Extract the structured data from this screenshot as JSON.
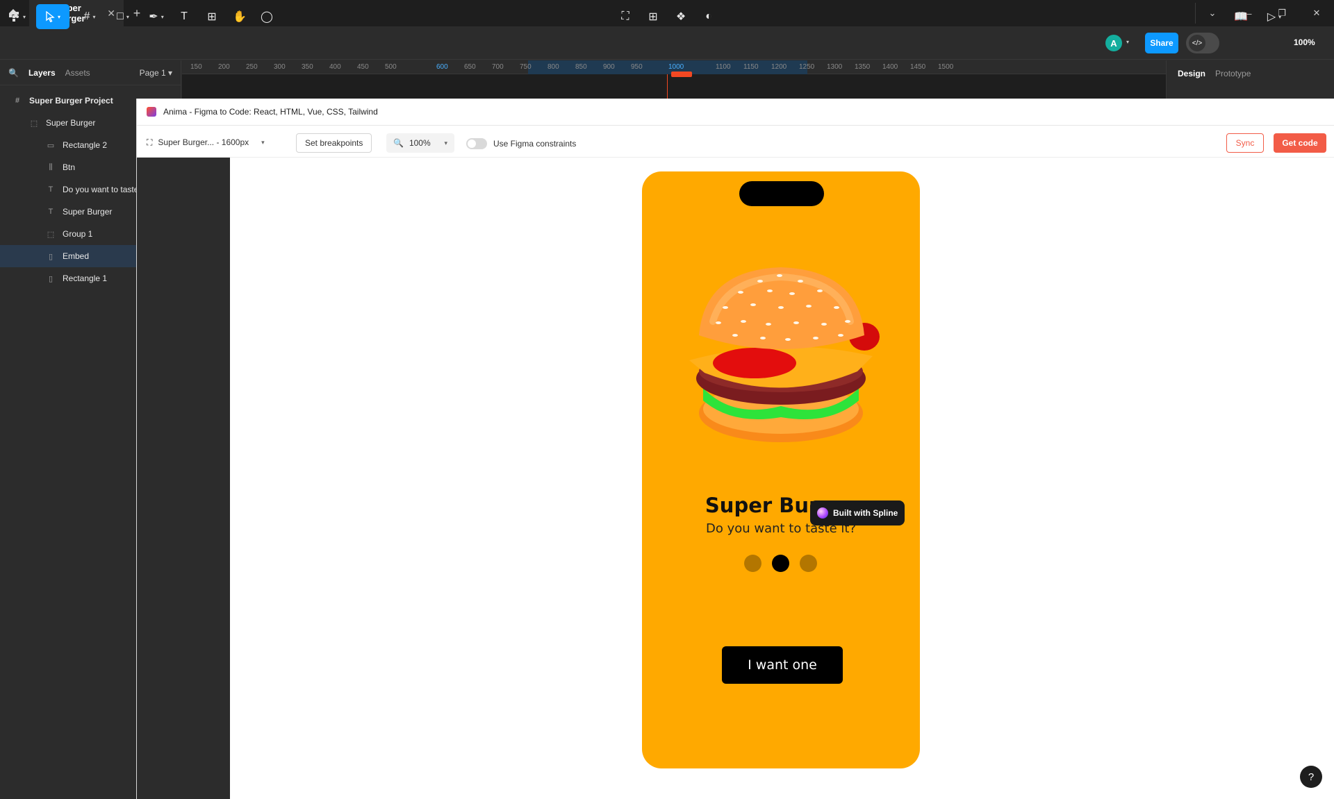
{
  "titlebar": {
    "tab_title": "Super Burger",
    "tab_close": "✕",
    "new_tab": "+"
  },
  "toolbar": {
    "share_label": "Share",
    "avatar_initial": "A",
    "zoom_level": "100%"
  },
  "left_panel": {
    "tabs": {
      "layers": "Layers",
      "assets": "Assets"
    },
    "page": "Page 1",
    "layers": [
      {
        "label": "Super Burger Project",
        "icon": "#"
      },
      {
        "label": "Super Burger",
        "icon": "⬚"
      },
      {
        "label": "Rectangle 2",
        "icon": "▭"
      },
      {
        "label": "Btn",
        "icon": "⫼"
      },
      {
        "label": "Do you want to taste it?",
        "icon": "T"
      },
      {
        "label": "Super Burger",
        "icon": "T"
      },
      {
        "label": "Group 1",
        "icon": "⬚"
      },
      {
        "label": "Embed",
        "icon": "▯"
      },
      {
        "label": "Rectangle 1",
        "icon": "▯"
      }
    ]
  },
  "right_panel": {
    "tabs": {
      "design": "Design",
      "prototype": "Prototype"
    }
  },
  "ruler": {
    "ticks": [
      "150",
      "200",
      "250",
      "300",
      "350",
      "400",
      "450",
      "500",
      "600",
      "650",
      "700",
      "750",
      "800",
      "850",
      "900",
      "950",
      "1000",
      "1100",
      "1150",
      "1200",
      "1250",
      "1300",
      "1350",
      "1400",
      "1450",
      "1500"
    ]
  },
  "plugin": {
    "title": "Anima - Figma to Code: React, HTML, Vue, CSS, Tailwind",
    "frame_select": "Super Burger... - 1600px",
    "breakpoints_label": "Set breakpoints",
    "zoom": "100%",
    "constraints_label": "Use Figma constraints",
    "sync_label": "Sync",
    "get_code_label": "Get code",
    "help": "?"
  },
  "phone": {
    "title": "Super Burger",
    "subtitle": "Do you want to taste it?",
    "spline_badge": "Built with Spline",
    "cta": "I want one",
    "dots": 3,
    "active_dot": 1
  },
  "colors": {
    "accent": "#0d99ff",
    "phone_bg": "#ffa900",
    "anima_red": "#f25c47"
  }
}
